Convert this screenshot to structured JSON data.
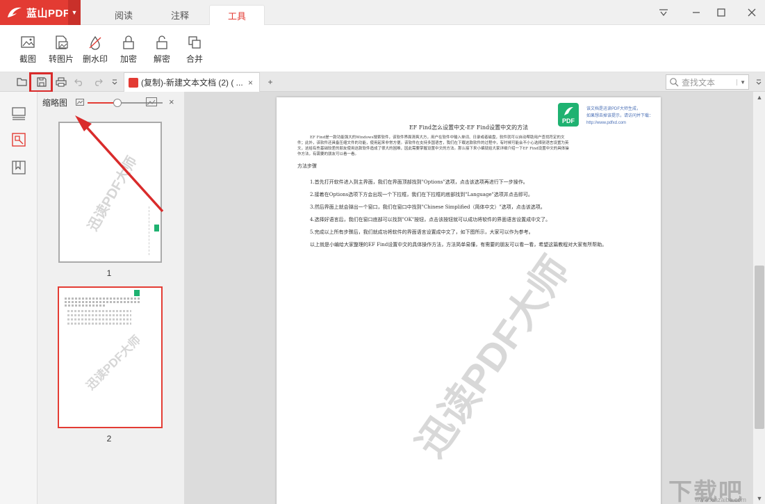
{
  "app": {
    "logo": "蓝山PDF",
    "tabs": [
      "阅读",
      "注释",
      "工具"
    ],
    "active_tab": "工具"
  },
  "ribbon": {
    "tools": [
      "截图",
      "转图片",
      "删水印",
      "加密",
      "解密",
      "合并"
    ]
  },
  "docbar": {
    "doc_title": "(复制)-新建文本文档 (2) ( ...",
    "close": "×",
    "add": "+",
    "search_placeholder": "查找文本"
  },
  "thumbnails": {
    "title": "缩略图",
    "close": "×",
    "zoom_fraction": 0.4,
    "pages": [
      "1",
      "2"
    ],
    "selected_page": "2",
    "watermark": "迅读PDF大师"
  },
  "document": {
    "title": "EF Find怎么设置中文-EF Find设置中文的方法",
    "intro": "EF Find是一款功能强大的Windows搜索软件，该软件界面清爽大方，用户在软件中输入单词、日录或者磁盘，软件就可以自动帮助用户查找符定的文件；此外，该软件还具备压缩文件的功能，使用起来非常方便。该软件在支持多国语言，我们在下载这款软件的过程中，有时候可能会不小心选择别语言设置为英文，这给有些基础较差的朋友使用这款软件造成了很大的困难，因此需要掌握设置中文的方法。那么接下来小编就给大家详细介绍一下EF Find设置中文的具体操作方法，有需要的朋友可以看一看。",
    "heading": "方法步骤",
    "steps": [
      "1.首先打开软件进入到主界面，我们在界面顶部找到\"Options\"选项，点击该选项再进行下一步操作。",
      "2.接着在Options选项下方会出现一个下拉框，我们在下拉框的底部找到\"Language\"选项并点击即可。",
      "3.然后界面上就会弹出一个窗口，我们在窗口中找到\"Chinese Simplified（简体中文）\"选项，点击该选项。",
      "4.选择好语言后，我们在窗口底部可以找到\"OK\"按钮，点击该按钮就可以成功将软件的界面语言设置成中文了。",
      "5.完成以上所有步骤后，我们就成功将软件的界面语言设置成中文了，如下图所示，大家可以作为参考。",
      "以上就是小编给大家整理的EF Find设置中文的具体操作方法，方法简单易懂，有需要的朋友可以看一看，希望这篇教程对大家有所帮助。"
    ],
    "badge": "PDF",
    "badge_note": [
      "该文档是迅读PDF大师生成，",
      "如果想去掉该提示，请访问并下载：",
      "http://www.pdfxd.com"
    ],
    "watermark": "迅读PDF大师"
  },
  "site_watermark": {
    "text": "下载吧",
    "url": "www.xiazaiba.com"
  },
  "colors": {
    "brand": "#e33b33",
    "badge": "#1fb271",
    "annotation": "#d92b2b"
  }
}
